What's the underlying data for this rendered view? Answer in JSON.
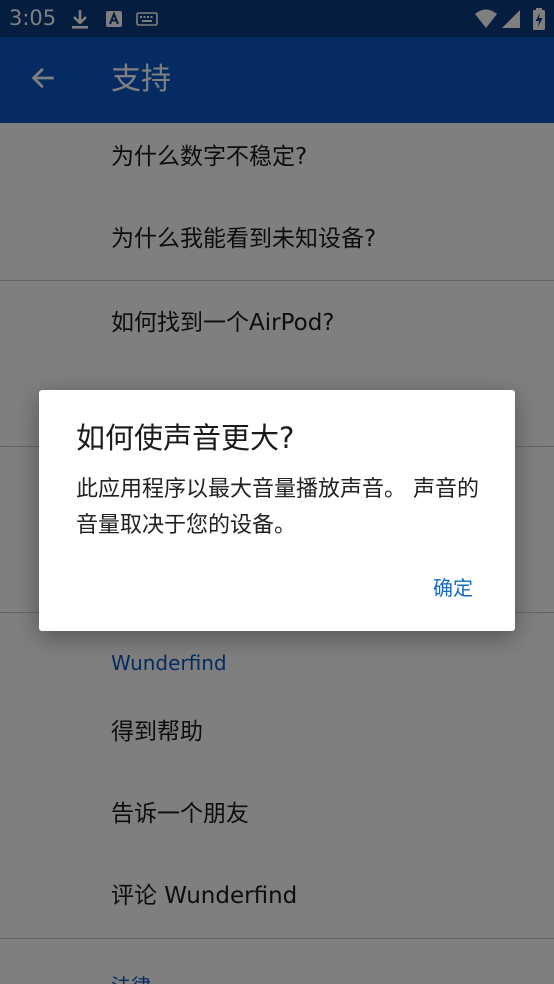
{
  "status_bar": {
    "time": "3:05",
    "icons": [
      "download-icon",
      "a-badge-icon",
      "keyboard-icon",
      "wifi-icon",
      "signal-icon",
      "battery-charging-icon"
    ]
  },
  "app_bar": {
    "back_icon": "arrow-left-icon",
    "title": "支持"
  },
  "faq_items": [
    "为什么数字不稳定?",
    "为什么我能看到未知设备?",
    "如何找到一个AirPod?"
  ],
  "wunderfind_section": {
    "header": "Wunderfind",
    "items": [
      "得到帮助",
      "告诉一个朋友",
      "评论 Wunderfind"
    ]
  },
  "legal_section": {
    "header": "法律"
  },
  "dialog": {
    "title": "如何使声音更大?",
    "message": "此应用程序以最大音量播放声音。 声音的音量取决于您的设备。",
    "ok_label": "确定"
  },
  "colors": {
    "status_bar": "#0b3a7e",
    "app_bar": "#0b58c4",
    "accent": "#1769c7"
  }
}
